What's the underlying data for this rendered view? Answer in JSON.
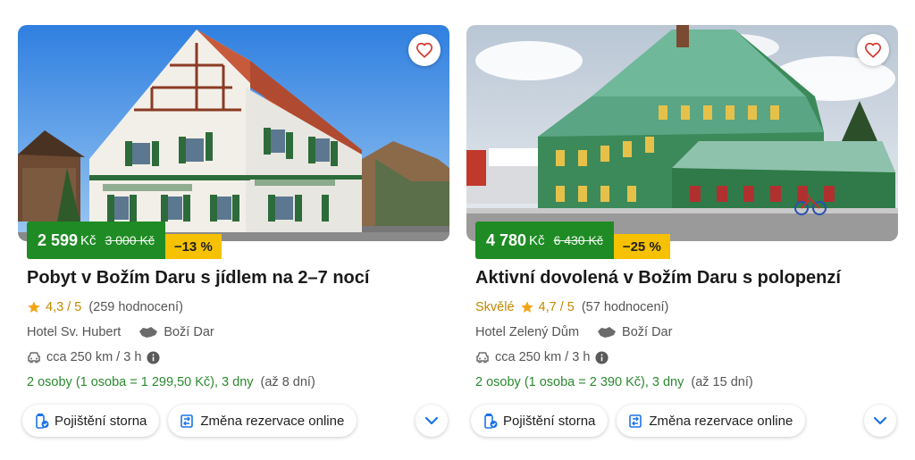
{
  "colors": {
    "price_green": "#1f8b24",
    "discount_yellow": "#f5c100",
    "rating_gold": "#c08a00",
    "persons_green": "#2a8a2f",
    "accent_blue": "#1a73e8"
  },
  "cards": [
    {
      "image": "hotel-sv-hubert-photo",
      "price": {
        "current": "2 599",
        "currency": "Kč",
        "original": "3 000 Kč",
        "discount": "−13 %"
      },
      "title": "Pobyt v Božím Daru s jídlem na 2–7 nocí",
      "rating": {
        "word": "",
        "score": "4,3 / 5",
        "count": "(259 hodnocení)"
      },
      "hotel": "Hotel Sv. Hubert",
      "region": "Boží Dar",
      "distance": "cca 250 km / 3 h",
      "persons": "2 osoby (1 osoba = 1 299,50 Kč), 3 dny",
      "persons_extra": "(až 8 dní)",
      "chips": [
        "Pojištění storna",
        "Změna rezervace online"
      ]
    },
    {
      "image": "hotel-zeleny-dum-photo",
      "price": {
        "current": "4 780",
        "currency": "Kč",
        "original": "6 430 Kč",
        "discount": "−25 %"
      },
      "title": "Aktivní dovolená v Božím Daru s polopenzí",
      "rating": {
        "word": "Skvělé",
        "score": "4,7 / 5",
        "count": "(57 hodnocení)"
      },
      "hotel": "Hotel Zelený Dům",
      "region": "Boží Dar",
      "distance": "cca 250 km / 3 h",
      "persons": "2 osoby (1 osoba = 2 390 Kč), 3 dny",
      "persons_extra": "(až 15 dní)",
      "chips": [
        "Pojištění storna",
        "Změna rezervace online"
      ]
    }
  ]
}
